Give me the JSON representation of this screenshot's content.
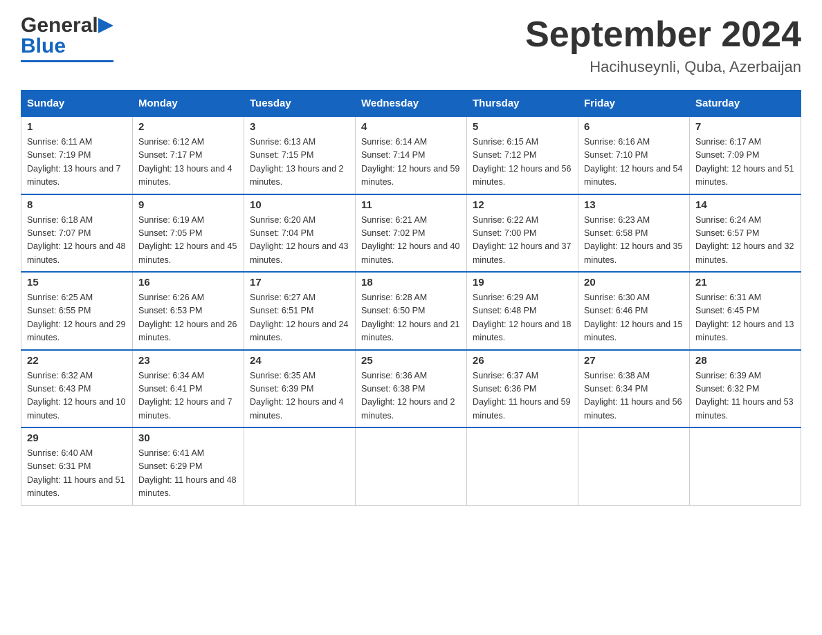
{
  "header": {
    "logo_general": "General",
    "logo_blue": "Blue",
    "month_year": "September 2024",
    "location": "Hacihuseynli, Quba, Azerbaijan"
  },
  "days_of_week": [
    "Sunday",
    "Monday",
    "Tuesday",
    "Wednesday",
    "Thursday",
    "Friday",
    "Saturday"
  ],
  "weeks": [
    [
      {
        "day": "1",
        "sunrise": "6:11 AM",
        "sunset": "7:19 PM",
        "daylight": "13 hours and 7 minutes."
      },
      {
        "day": "2",
        "sunrise": "6:12 AM",
        "sunset": "7:17 PM",
        "daylight": "13 hours and 4 minutes."
      },
      {
        "day": "3",
        "sunrise": "6:13 AM",
        "sunset": "7:15 PM",
        "daylight": "13 hours and 2 minutes."
      },
      {
        "day": "4",
        "sunrise": "6:14 AM",
        "sunset": "7:14 PM",
        "daylight": "12 hours and 59 minutes."
      },
      {
        "day": "5",
        "sunrise": "6:15 AM",
        "sunset": "7:12 PM",
        "daylight": "12 hours and 56 minutes."
      },
      {
        "day": "6",
        "sunrise": "6:16 AM",
        "sunset": "7:10 PM",
        "daylight": "12 hours and 54 minutes."
      },
      {
        "day": "7",
        "sunrise": "6:17 AM",
        "sunset": "7:09 PM",
        "daylight": "12 hours and 51 minutes."
      }
    ],
    [
      {
        "day": "8",
        "sunrise": "6:18 AM",
        "sunset": "7:07 PM",
        "daylight": "12 hours and 48 minutes."
      },
      {
        "day": "9",
        "sunrise": "6:19 AM",
        "sunset": "7:05 PM",
        "daylight": "12 hours and 45 minutes."
      },
      {
        "day": "10",
        "sunrise": "6:20 AM",
        "sunset": "7:04 PM",
        "daylight": "12 hours and 43 minutes."
      },
      {
        "day": "11",
        "sunrise": "6:21 AM",
        "sunset": "7:02 PM",
        "daylight": "12 hours and 40 minutes."
      },
      {
        "day": "12",
        "sunrise": "6:22 AM",
        "sunset": "7:00 PM",
        "daylight": "12 hours and 37 minutes."
      },
      {
        "day": "13",
        "sunrise": "6:23 AM",
        "sunset": "6:58 PM",
        "daylight": "12 hours and 35 minutes."
      },
      {
        "day": "14",
        "sunrise": "6:24 AM",
        "sunset": "6:57 PM",
        "daylight": "12 hours and 32 minutes."
      }
    ],
    [
      {
        "day": "15",
        "sunrise": "6:25 AM",
        "sunset": "6:55 PM",
        "daylight": "12 hours and 29 minutes."
      },
      {
        "day": "16",
        "sunrise": "6:26 AM",
        "sunset": "6:53 PM",
        "daylight": "12 hours and 26 minutes."
      },
      {
        "day": "17",
        "sunrise": "6:27 AM",
        "sunset": "6:51 PM",
        "daylight": "12 hours and 24 minutes."
      },
      {
        "day": "18",
        "sunrise": "6:28 AM",
        "sunset": "6:50 PM",
        "daylight": "12 hours and 21 minutes."
      },
      {
        "day": "19",
        "sunrise": "6:29 AM",
        "sunset": "6:48 PM",
        "daylight": "12 hours and 18 minutes."
      },
      {
        "day": "20",
        "sunrise": "6:30 AM",
        "sunset": "6:46 PM",
        "daylight": "12 hours and 15 minutes."
      },
      {
        "day": "21",
        "sunrise": "6:31 AM",
        "sunset": "6:45 PM",
        "daylight": "12 hours and 13 minutes."
      }
    ],
    [
      {
        "day": "22",
        "sunrise": "6:32 AM",
        "sunset": "6:43 PM",
        "daylight": "12 hours and 10 minutes."
      },
      {
        "day": "23",
        "sunrise": "6:34 AM",
        "sunset": "6:41 PM",
        "daylight": "12 hours and 7 minutes."
      },
      {
        "day": "24",
        "sunrise": "6:35 AM",
        "sunset": "6:39 PM",
        "daylight": "12 hours and 4 minutes."
      },
      {
        "day": "25",
        "sunrise": "6:36 AM",
        "sunset": "6:38 PM",
        "daylight": "12 hours and 2 minutes."
      },
      {
        "day": "26",
        "sunrise": "6:37 AM",
        "sunset": "6:36 PM",
        "daylight": "11 hours and 59 minutes."
      },
      {
        "day": "27",
        "sunrise": "6:38 AM",
        "sunset": "6:34 PM",
        "daylight": "11 hours and 56 minutes."
      },
      {
        "day": "28",
        "sunrise": "6:39 AM",
        "sunset": "6:32 PM",
        "daylight": "11 hours and 53 minutes."
      }
    ],
    [
      {
        "day": "29",
        "sunrise": "6:40 AM",
        "sunset": "6:31 PM",
        "daylight": "11 hours and 51 minutes."
      },
      {
        "day": "30",
        "sunrise": "6:41 AM",
        "sunset": "6:29 PM",
        "daylight": "11 hours and 48 minutes."
      },
      null,
      null,
      null,
      null,
      null
    ]
  ],
  "labels": {
    "sunrise": "Sunrise:",
    "sunset": "Sunset:",
    "daylight": "Daylight:"
  }
}
